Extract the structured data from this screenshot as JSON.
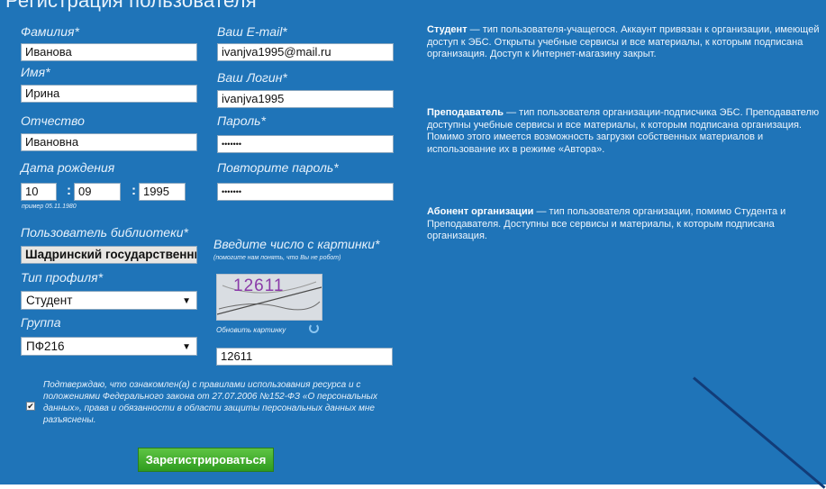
{
  "page_title": "Регистрация пользователя",
  "left_col": {
    "surname": {
      "label": "Фамилия*",
      "value": "Иванова"
    },
    "name": {
      "label": "Имя*",
      "value": "Ирина"
    },
    "patronymic": {
      "label": "Отчество",
      "value": "Ивановна"
    },
    "birthdate": {
      "label": "Дата рождения",
      "day": "10",
      "month": "09",
      "year": "1995",
      "example": "пример 05.11.1980"
    },
    "library_user": {
      "label": "Пользователь библиотеки*",
      "value": "Шадринский государственный"
    },
    "profile_type": {
      "label": "Тип профиля*",
      "value": "Студент"
    },
    "group": {
      "label": "Группа",
      "value": "ПФ216"
    }
  },
  "mid_col": {
    "email": {
      "label": "Ваш E-mail*",
      "value": "ivanjva1995@mail.ru"
    },
    "login": {
      "label": "Ваш Логин*",
      "value": "ivanjva1995"
    },
    "password": {
      "label": "Пароль*",
      "value": "•••••••"
    },
    "password_repeat": {
      "label": "Повторите пароль*",
      "value": "•••••••"
    },
    "captcha": {
      "label": "Введите число с картинки*",
      "hint": "(помогите нам понять, что Вы не робот)",
      "image_text": "12611",
      "refresh_label": "Обновить картинку",
      "value": "12611"
    }
  },
  "agreement": {
    "text": "Подтверждаю, что ознакомлен(а) с правилами использования ресурса и с положениями Федерального закона от 27.07.2006 №152-ФЗ «О персональных данных», права и обязанности в области защиты персональных данных мне разъяснены.",
    "checked_glyph": "✔"
  },
  "submit_label": "Зарегистрироваться",
  "descriptions": [
    {
      "term": "Студент",
      "text": " — тип пользователя-учащегося. Аккаунт привязан к организации, имеющей доступ к ЭБС. Открыты учебные сервисы и все материалы, к которым подписана организация. Доступ к Интернет-магазину закрыт."
    },
    {
      "term": "Преподаватель",
      "text": " — тип пользователя организации-подписчика ЭБС. Преподавателю доступны учебные сервисы и все материалы, к которым подписана организация. Помимо этого имеется возможность загрузки собственных материалов и использование их в режиме «Автора»."
    },
    {
      "term": "Абонент организации",
      "text": " — тип пользователя организации, помимо Студента и Преподавателя. Доступны все сервисы и материалы, к которым подписана организация."
    }
  ],
  "colors": {
    "panel": "#1f74b8",
    "button": "#3fae2a",
    "label": "#e6f1fb"
  }
}
